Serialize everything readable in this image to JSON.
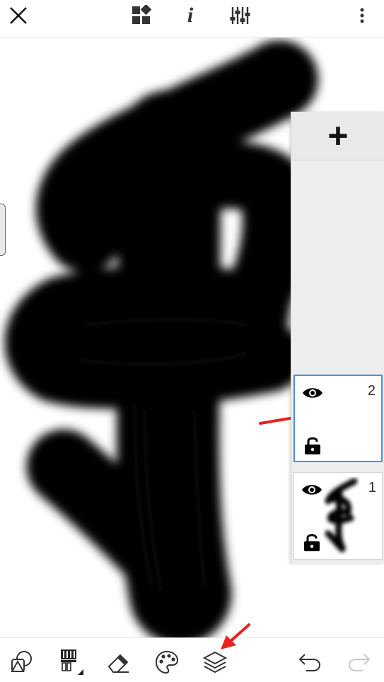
{
  "topbar": {
    "close": "close-icon",
    "gallery": "widgets-icon",
    "info": "i",
    "adjust": "sliders-icon",
    "menu": "more-vertical-icon"
  },
  "layers": {
    "add_label": "+",
    "items": [
      {
        "number": "2",
        "visible": true,
        "locked": false,
        "selected": true
      },
      {
        "number": "1",
        "visible": true,
        "locked": false,
        "selected": false
      }
    ]
  },
  "bottombar": {
    "tools": [
      "shapes-icon",
      "brush-icon",
      "eraser-icon",
      "palette-icon",
      "layers-icon"
    ],
    "undo": "undo-icon",
    "redo": "redo-icon"
  },
  "colors": {
    "accent": "#4f8fd8",
    "annotation": "#e8231f",
    "ink": "#000000"
  }
}
